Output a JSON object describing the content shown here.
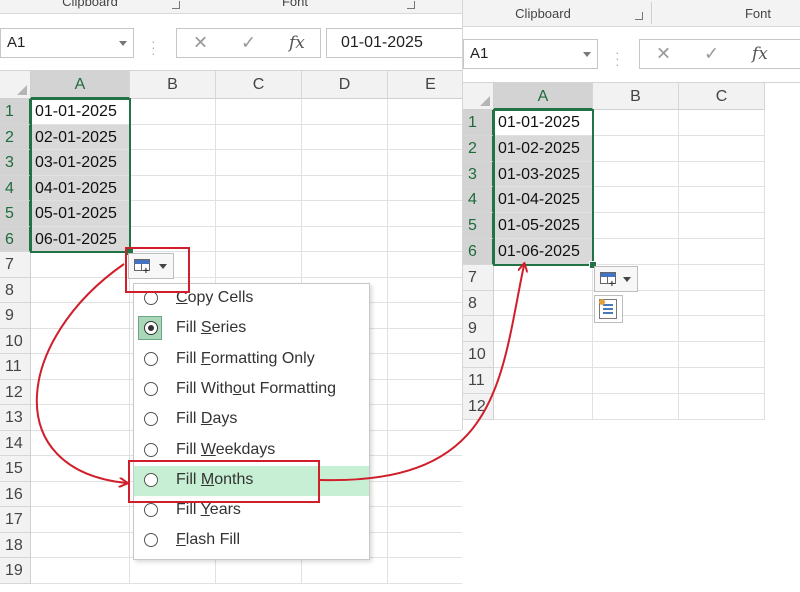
{
  "colors": {
    "accent": "#217346",
    "annotation": "#d01f2b",
    "highlight": "#c6efd3"
  },
  "left": {
    "ribbon": {
      "clipboard": "Clipboard",
      "font": "Font"
    },
    "name_box": "A1",
    "formula_value": "01-01-2025",
    "fx_label": "fx",
    "cancel_icon": "✕",
    "enter_icon": "✓",
    "columns": [
      "A",
      "B",
      "C",
      "D",
      "E"
    ],
    "rows": [
      "1",
      "2",
      "3",
      "4",
      "5",
      "6",
      "7",
      "8",
      "9",
      "10",
      "11",
      "12",
      "13",
      "14",
      "15",
      "16",
      "17",
      "18",
      "19"
    ],
    "cells": [
      "01-01-2025",
      "02-01-2025",
      "03-01-2025",
      "04-01-2025",
      "05-01-2025",
      "06-01-2025"
    ],
    "menu": [
      {
        "pre": "",
        "acc": "C",
        "post": "opy Cells"
      },
      {
        "pre": "Fill ",
        "acc": "S",
        "post": "eries"
      },
      {
        "pre": "Fill ",
        "acc": "F",
        "post": "ormatting Only"
      },
      {
        "pre": "Fill With",
        "acc": "o",
        "post": "ut Formatting"
      },
      {
        "pre": "Fill ",
        "acc": "D",
        "post": "ays"
      },
      {
        "pre": "Fill ",
        "acc": "W",
        "post": "eekdays"
      },
      {
        "pre": "Fill ",
        "acc": "M",
        "post": "onths"
      },
      {
        "pre": "Fill ",
        "acc": "Y",
        "post": "ears"
      },
      {
        "pre": "",
        "acc": "F",
        "post": "lash Fill"
      }
    ]
  },
  "right": {
    "ribbon": {
      "clipboard": "Clipboard",
      "font": "Font"
    },
    "name_box": "A1",
    "fx_label": "fx",
    "cancel_icon": "✕",
    "enter_icon": "✓",
    "columns": [
      "A",
      "B",
      "C"
    ],
    "rows": [
      "1",
      "2",
      "3",
      "4",
      "5",
      "6",
      "7",
      "8",
      "9",
      "10",
      "11",
      "12"
    ],
    "cells": [
      "01-01-2025",
      "01-02-2025",
      "01-03-2025",
      "01-04-2025",
      "01-05-2025",
      "01-06-2025"
    ]
  }
}
